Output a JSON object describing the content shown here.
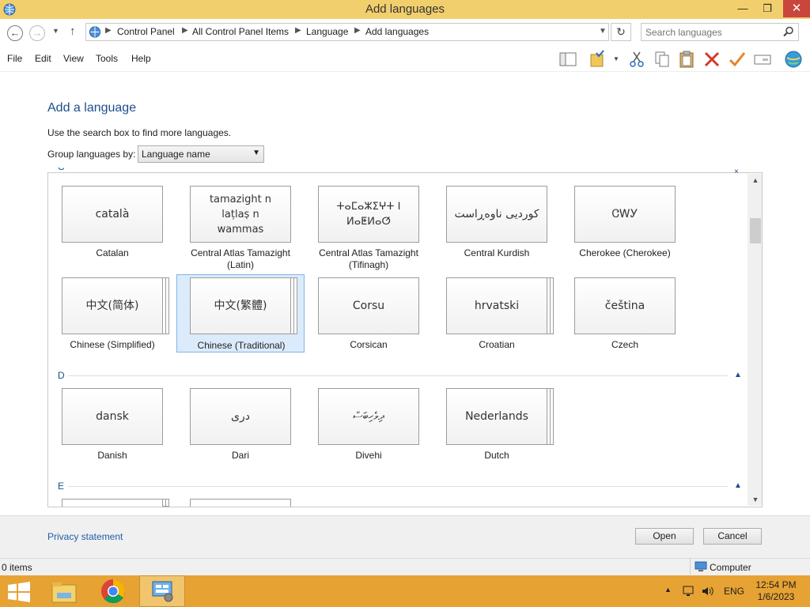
{
  "window": {
    "title": "Add languages"
  },
  "address": {
    "crumbs": [
      "Control Panel",
      "All Control Panel Items",
      "Language",
      "Add languages"
    ]
  },
  "search": {
    "placeholder": "Search languages"
  },
  "menu": [
    "File",
    "Edit",
    "View",
    "Tools",
    "Help"
  ],
  "content": {
    "heading": "Add a language",
    "hint": "Use the search box to find more languages.",
    "group_label": "Group languages by:",
    "group_value": "Language name"
  },
  "groups": [
    {
      "letter": "C"
    },
    {
      "letter": "D"
    },
    {
      "letter": "E"
    }
  ],
  "tiles": [
    {
      "native": "català",
      "name": "Catalan"
    },
    {
      "native": "tamazight n laṭlaṣ n wammas",
      "name": "Central Atlas Tamazight (Latin)"
    },
    {
      "native": "ⵜⴰⵎⴰⵣⵉⵖⵜ ⵏ ⵍⴰⵟⵍⴰⵚ",
      "name": "Central Atlas Tamazight (Tifinagh)"
    },
    {
      "native": "کوردیی ناوەڕاست",
      "name": "Central Kurdish"
    },
    {
      "native": "ᏣᎳᎩ",
      "name": "Cherokee (Cherokee)"
    },
    {
      "native": "中文(简体)",
      "name": "Chinese (Simplified)"
    },
    {
      "native": "中文(繁體)",
      "name": "Chinese (Traditional)"
    },
    {
      "native": "Corsu",
      "name": "Corsican"
    },
    {
      "native": "hrvatski",
      "name": "Croatian"
    },
    {
      "native": "čeština",
      "name": "Czech"
    },
    {
      "native": "dansk",
      "name": "Danish"
    },
    {
      "native": "دری",
      "name": "Dari"
    },
    {
      "native": "ދިވެހިބަސް",
      "name": "Divehi"
    },
    {
      "native": "Nederlands",
      "name": "Dutch"
    }
  ],
  "footer": {
    "privacy": "Privacy statement",
    "open": "Open",
    "cancel": "Cancel"
  },
  "status": {
    "items": "0 items",
    "location": "Computer"
  },
  "taskbar": {
    "language": "ENG",
    "time": "12:54 PM",
    "date": "1/6/2023"
  },
  "colors": {
    "titlebar": "#f2cf6d",
    "taskbar": "#e7a234",
    "link": "#1e5ea8",
    "selection": "#dcebfc"
  }
}
